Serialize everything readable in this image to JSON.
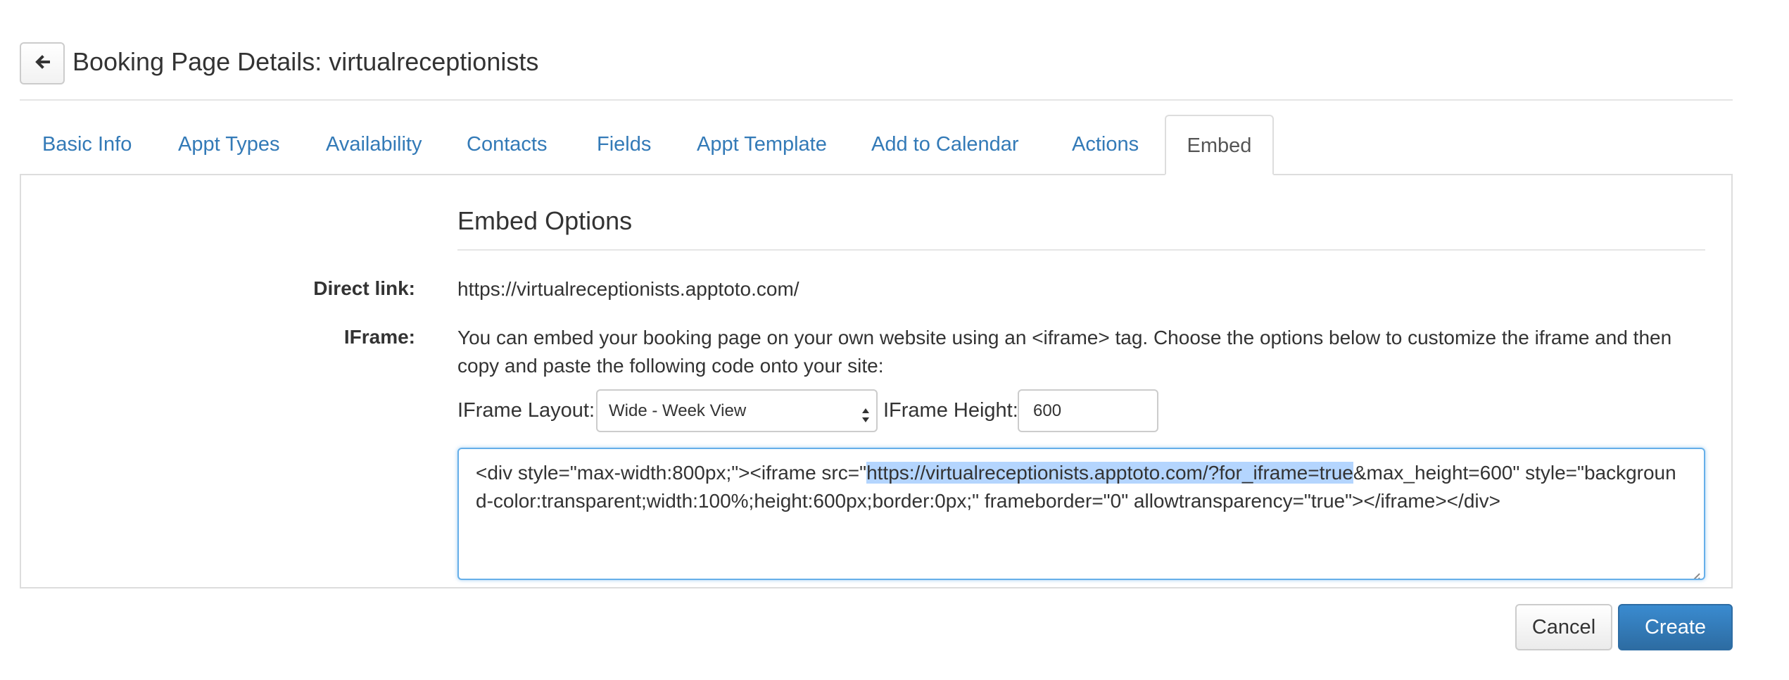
{
  "header": {
    "title": "Booking Page Details: virtualreceptionists",
    "back_icon": "arrow-left-icon"
  },
  "tabs": [
    {
      "label": "Basic Info",
      "active": false
    },
    {
      "label": "Appt Types",
      "active": false
    },
    {
      "label": "Availability",
      "active": false
    },
    {
      "label": "Contacts",
      "active": false
    },
    {
      "label": "Fields",
      "active": false
    },
    {
      "label": "Appt Template",
      "active": false
    },
    {
      "label": "Add to Calendar",
      "active": false
    },
    {
      "label": "Actions",
      "active": false
    },
    {
      "label": "Embed",
      "active": true
    }
  ],
  "embed": {
    "section_title": "Embed Options",
    "direct_link_label": "Direct link:",
    "direct_link_value": "https://virtualreceptionists.apptoto.com/",
    "iframe_label": "IFrame:",
    "iframe_description": "You can embed your booking page on your own website using an <iframe> tag. Choose the options below to customize the iframe and then copy and paste the following code onto your site:",
    "layout_label": "IFrame Layout:",
    "layout_selected": "Wide - Week View",
    "height_label": "IFrame Height:",
    "height_value": "600",
    "code_before": "<div style=\"max-width:800px;\"><iframe src=\"",
    "code_selected": "https://virtualreceptionists.apptoto.com/?for_iframe=true",
    "code_after": "&max_height=600\" style=\"background-color:transparent;width:100%;height:600px;border:0px;\" frameborder=\"0\" allowtransparency=\"true\"></iframe></div>"
  },
  "footer": {
    "cancel_label": "Cancel",
    "create_label": "Create"
  },
  "colors": {
    "link": "#337ab7",
    "primary": "#337ab7",
    "focus_border": "#66afe9",
    "selection": "#b4d5fe"
  }
}
